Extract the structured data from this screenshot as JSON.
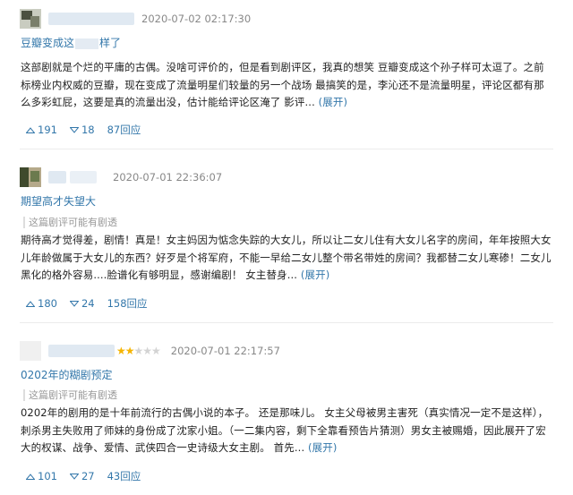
{
  "reviews": [
    {
      "author_avatar_colors": [
        "#7a7f6b",
        "#c9ccc0",
        "#4b5040"
      ],
      "stars_on": 0,
      "stars_total": 0,
      "date": "2020-07-02 02:17:30",
      "title_part1": "豆瓣变成这",
      "title_part2": "样了",
      "spoiler": "",
      "body": "这部剧就是个烂的平庸的古偶。没啥可评价的，但是看到剧评区，我真的想笑 豆瓣变成这个孙子样可太逗了。之前标榜业内权威的豆瓣，现在变成了流量明星们较量的另一个战场 最搞笑的是，李沁还不是流量明星，评论区都有那么多彩虹屁，这要是真的流量出没，估计能给评论区淹了 影评...",
      "expand": "(展开)",
      "up": "191",
      "down": "18",
      "reply": "87回应"
    },
    {
      "author_avatar_colors": [
        "#6b7a4e",
        "#b5a98a",
        "#3f4a2d"
      ],
      "stars_on": 0,
      "stars_total": 0,
      "date": "2020-07-01 22:36:07",
      "title_part1": "期望高才失望大",
      "title_part2": "",
      "spoiler": "这篇剧评可能有剧透",
      "body": "期待高才觉得差，剧情！真是！女主妈因为惦念失踪的大女儿，所以让二女儿住有大女儿名字的房间，年年按照大女儿年龄做属于大女儿的东西？好歹是个将军府，不能一早给二女儿整个带名带姓的房间？我都替二女儿寒碜！二女儿黑化的格外容易....脸谱化有够明显，感谢编剧！ 女主替身...",
      "expand": "(展开)",
      "up": "180",
      "down": "24",
      "reply": "158回应"
    },
    {
      "author_avatar_colors": [
        "#f0f0f0",
        "#f0f0f0",
        "#f0f0f0"
      ],
      "stars_on": 2,
      "stars_total": 5,
      "date": "2020-07-01 22:17:57",
      "title_part1": "0202年的糊剧预定",
      "title_part2": "",
      "spoiler": "这篇剧评可能有剧透",
      "body": "0202年的剧用的是十年前流行的古偶小说的本子。 还是那味儿。 女主父母被男主害死（真实情况一定不是这样），刺杀男主失败用了师妹的身份成了沈家小姐。（一二集内容，剩下全靠看预告片猜测）男女主被赐婚，因此展开了宏大的权谋、战争、爱情、武侠四合一史诗级大女主剧。 首先...",
      "expand": "(展开)",
      "up": "101",
      "down": "27",
      "reply": "43回应"
    }
  ]
}
